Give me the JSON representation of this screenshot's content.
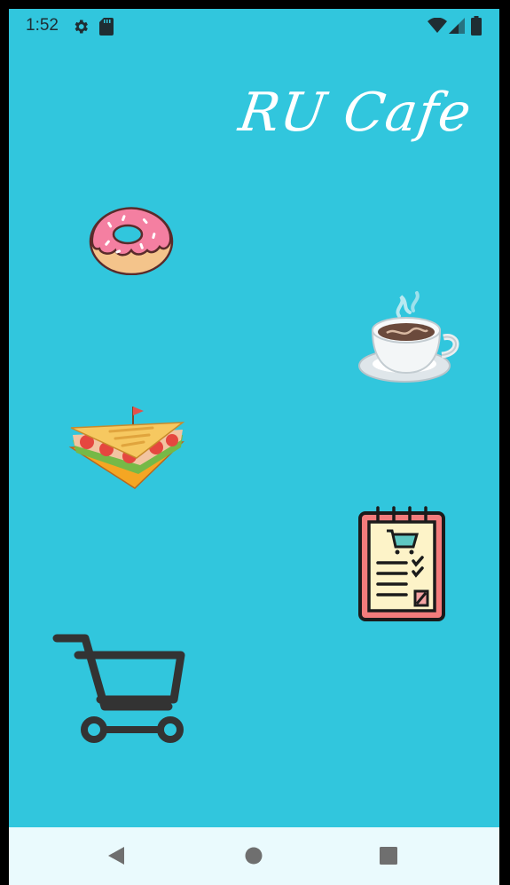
{
  "status_bar": {
    "time": "1:52",
    "icons": [
      "settings-icon",
      "sd-card-icon",
      "wifi-icon",
      "cell-signal-icon",
      "battery-icon"
    ]
  },
  "app": {
    "title": "RU Cafe",
    "background_color": "#31c6dd"
  },
  "menu": [
    {
      "icon": "donut-icon"
    },
    {
      "icon": "coffee-icon"
    },
    {
      "icon": "sandwich-icon"
    },
    {
      "icon": "order-list-icon"
    },
    {
      "icon": "shopping-cart-icon"
    }
  ],
  "nav_bar": {
    "buttons": [
      "back-icon",
      "home-icon",
      "recents-icon"
    ]
  }
}
